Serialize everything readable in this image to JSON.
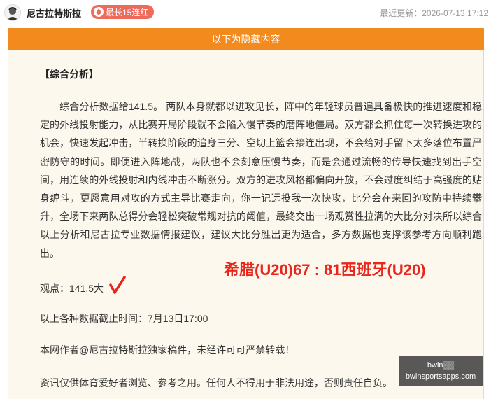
{
  "header": {
    "author_name": "尼古拉特斯拉",
    "streak_badge": "最长15连红",
    "updated": "最近更新：2026-07-13 17:12"
  },
  "content": {
    "hidden_banner": "以下为隐藏内容",
    "section_title": "【综合分析】",
    "analysis_text": "综合分析数据给141.5。 两队本身就都以进攻见长，阵中的年轻球员普遍具备极快的推进速度和稳定的外线投射能力，从比赛开局阶段就不会陷入慢节奏的磨阵地僵局。双方都会抓住每一次转换进攻的机会，快速发起冲击，半转换阶段的追身三分、空切上篮会接连出现，不会给对手留下太多落位布置严密防守的时间。即便进入阵地战，两队也不会刻意压慢节奏，而是会通过流畅的传导快速找到出手空间，用连续的外线投射和内线冲击不断涨分。双方的进攻风格都偏向开放，不会过度纠结于高强度的贴身缠斗，更愿意用对攻的方式主导比赛走向，你一记远投我一次快攻，比分会在来回的攻防中持续攀升，全场下来两队总得分会轻松突破常规对抗的阈值，最终交出一场观赏性拉满的大比分对决所以综合以上分析和尼古拉专业数据情报建议，建议大比分胜出更为适合，多方数据也支撑该参考方向顺利跑出。",
    "result_overlay": "希腊(U20)67 : 81西班牙(U20)",
    "viewpoint": "观点：141.5大",
    "deadline": "以上各种数据截止时间：7月13日17:00",
    "copyright": "本网作者@尼古拉特斯拉独家稿件，未经许可可严禁转载！",
    "disclaimer": "资讯仅供体育爱好者浏览、参考之用。任何人不得用于非法用途，否则责任自负。"
  },
  "watermark": {
    "line1": "bwin▒▒",
    "line2": "bwinsportsapps.com"
  },
  "colors": {
    "banner": "#f28a1e",
    "badge": "#ee6a5a",
    "result": "#e8261b",
    "panel": "#fdf8ee"
  }
}
